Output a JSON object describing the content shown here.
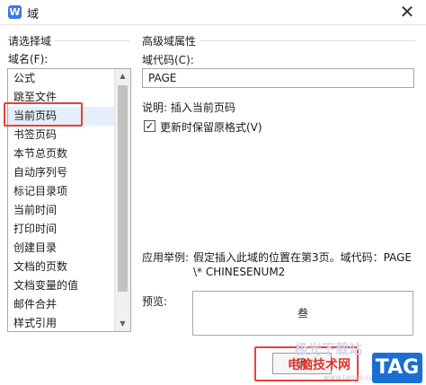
{
  "window": {
    "title": "域",
    "icon": "wps-writer-icon",
    "close_glyph": "✕"
  },
  "left_panel": {
    "group_title": "请选择域",
    "list_label": "域名(F):",
    "items": [
      "公式",
      "跳至文件",
      "当前页码",
      "书签页码",
      "本节总页数",
      "自动序列号",
      "标记目录项",
      "当前时间",
      "打印时间",
      "创建目录",
      "文档的页数",
      "文档变量的值",
      "邮件合并",
      "样式引用"
    ],
    "selected_item": "当前页码"
  },
  "right_panel": {
    "group_title": "高级域属性",
    "code_label": "域代码(C):",
    "code_value": "PAGE",
    "description": "说明: 插入当前页码",
    "checkbox_label": "更新时保留原格式(V)",
    "checkbox_checked": true,
    "example_label": "应用举例:",
    "example_line1": "假定插入此域的位置在第3页。域代码：PAGE",
    "example_line2": "\\* CHINESENUM2",
    "preview_label": "预览:",
    "preview_value": "叁"
  },
  "buttons": {
    "ok_label": "确"
  },
  "watermark": {
    "text": "电脑技术网",
    "faint": "极光下载站",
    "url": "www.tagxp.com",
    "tag": "TAG"
  },
  "colors": {
    "highlight": "#e8403a",
    "selection": "#e5eefb",
    "tag_badge": "#1b6fd3",
    "watermark_red": "#e2332a"
  }
}
